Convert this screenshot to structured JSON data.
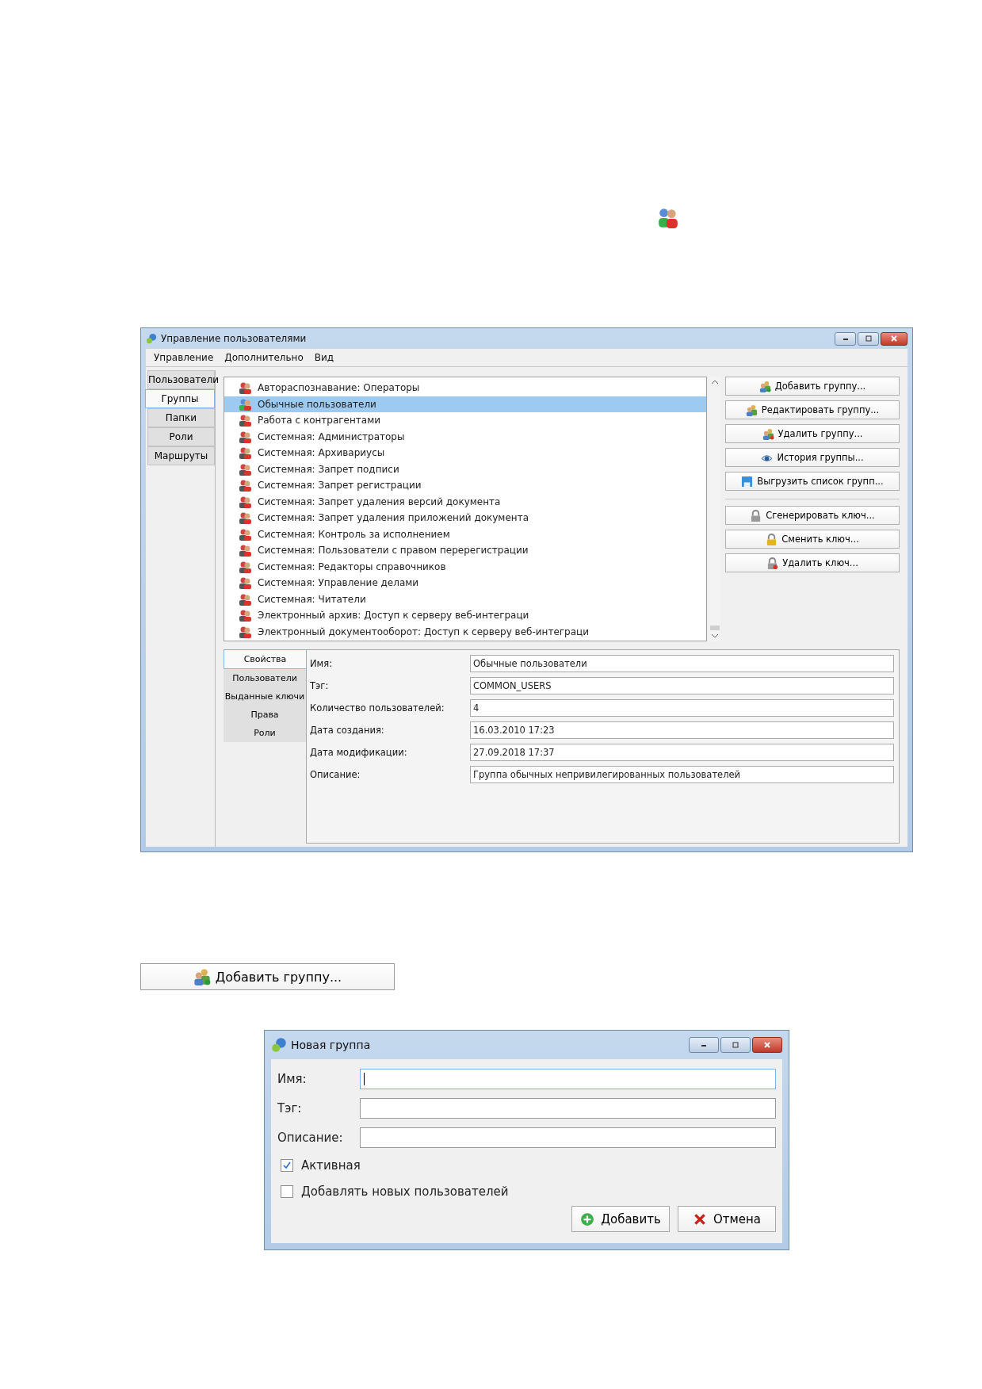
{
  "main_window": {
    "title": "Управление пользователями",
    "menu": [
      "Управление",
      "Дополнительно",
      "Вид"
    ],
    "side_tabs": [
      {
        "label": "Пользователи",
        "selected": false
      },
      {
        "label": "Группы",
        "selected": true
      },
      {
        "label": "Папки",
        "selected": false
      },
      {
        "label": "Роли",
        "selected": false
      },
      {
        "label": "Маршруты",
        "selected": false
      }
    ],
    "groups": [
      {
        "label": "Автораспознавание: Операторы",
        "selected": false
      },
      {
        "label": "Обычные пользователи",
        "selected": true
      },
      {
        "label": "Работа с контрагентами",
        "selected": false
      },
      {
        "label": "Системная: Администраторы",
        "selected": false
      },
      {
        "label": "Системная: Архивариусы",
        "selected": false
      },
      {
        "label": "Системная: Запрет подписи",
        "selected": false
      },
      {
        "label": "Системная: Запрет регистрации",
        "selected": false
      },
      {
        "label": "Системная: Запрет удаления версий документа",
        "selected": false
      },
      {
        "label": "Системная: Запрет удаления приложений документа",
        "selected": false
      },
      {
        "label": "Системная: Контроль за исполнением",
        "selected": false
      },
      {
        "label": "Системная: Пользователи с правом перерегистрации",
        "selected": false
      },
      {
        "label": "Системная: Редакторы справочников",
        "selected": false
      },
      {
        "label": "Системная: Управление делами",
        "selected": false
      },
      {
        "label": "Системная: Читатели",
        "selected": false
      },
      {
        "label": "Электронный архив: Доступ к серверу веб-интеграци",
        "selected": false
      },
      {
        "label": "Электронный документооборот: Доступ к серверу веб-интеграци",
        "selected": false
      }
    ],
    "group_buttons": [
      "Добавить группу...",
      "Редактировать группу...",
      "Удалить группу...",
      "История группы...",
      "Выгрузить список групп..."
    ],
    "key_buttons": [
      "Сгенерировать ключ...",
      "Сменить ключ...",
      "Удалить ключ..."
    ],
    "detail_tabs": [
      {
        "label": "Свойства",
        "selected": true
      },
      {
        "label": "Пользователи",
        "selected": false
      },
      {
        "label": "Выданные ключи",
        "selected": false
      },
      {
        "label": "Права",
        "selected": false
      },
      {
        "label": "Роли",
        "selected": false
      }
    ],
    "properties": [
      {
        "label": "Имя:",
        "value": "Обычные пользователи"
      },
      {
        "label": "Тэг:",
        "value": "COMMON_USERS"
      },
      {
        "label": "Количество пользователей:",
        "value": "4"
      },
      {
        "label": "Дата создания:",
        "value": "16.03.2010 17:23"
      },
      {
        "label": "Дата модификации:",
        "value": "27.09.2018 17:37"
      },
      {
        "label": "Описание:",
        "value": "Группа обычных непривилегированных пользователей"
      }
    ]
  },
  "standalone_button": "Добавить группу...",
  "dialog": {
    "title": "Новая группа",
    "fields": [
      {
        "label": "Имя:",
        "focused": true
      },
      {
        "label": "Тэг:",
        "focused": false
      },
      {
        "label": "Описание:",
        "focused": false
      }
    ],
    "checkboxes": [
      {
        "label": "Активная",
        "checked": true
      },
      {
        "label": "Добавлять новых пользователей",
        "checked": false
      }
    ],
    "buttons": [
      {
        "label": "Добавить",
        "kind": "ok"
      },
      {
        "label": "Отмена",
        "kind": "cancel"
      }
    ]
  }
}
